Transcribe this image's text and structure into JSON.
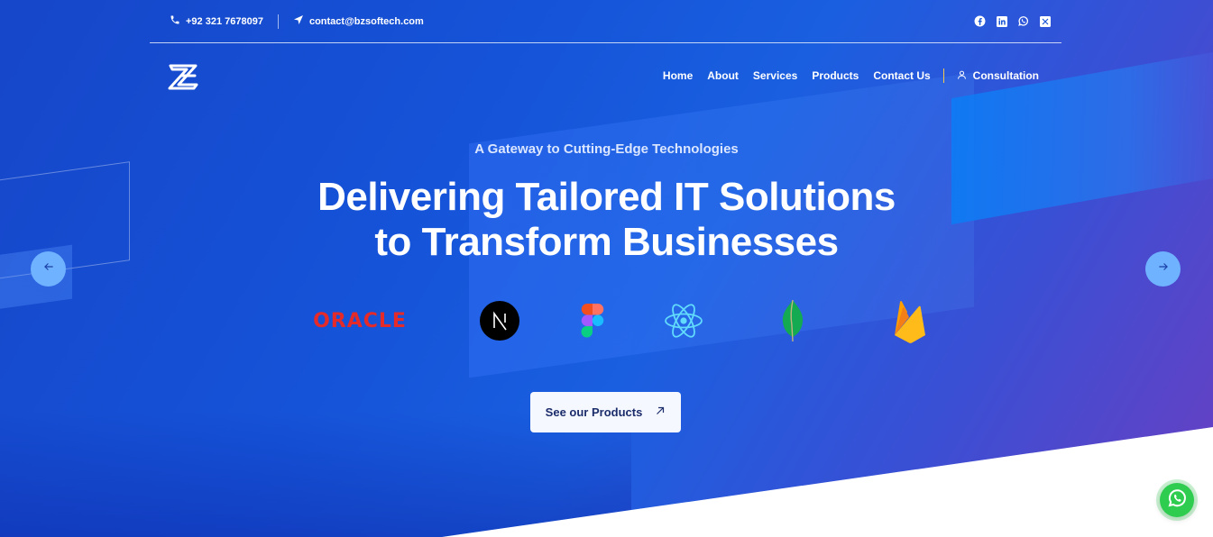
{
  "topbar": {
    "phone": "+92 321 7678097",
    "email": "contact@bzsoftech.com",
    "socials": [
      {
        "icon": "facebook-icon"
      },
      {
        "icon": "linkedin-icon"
      },
      {
        "icon": "whatsapp-icon"
      },
      {
        "icon": "x-twitter-icon"
      }
    ]
  },
  "nav": {
    "items": [
      {
        "label": "Home"
      },
      {
        "label": "About"
      },
      {
        "label": "Services"
      },
      {
        "label": "Products"
      },
      {
        "label": "Contact Us"
      }
    ],
    "consultation": "Consultation"
  },
  "hero": {
    "tagline": "A Gateway to Cutting-Edge Technologies",
    "headline_line1": "Delivering Tailored IT Solutions",
    "headline_line2": "to Transform Businesses",
    "tech_logos": {
      "oracle": "ORACLE",
      "next": "N"
    },
    "cta": "See our Products"
  },
  "colors": {
    "accent": "#1553d8",
    "oracle_red": "#e52a2a",
    "whatsapp_green": "#2ecc4f",
    "separator_yellow": "#f2c94c"
  }
}
